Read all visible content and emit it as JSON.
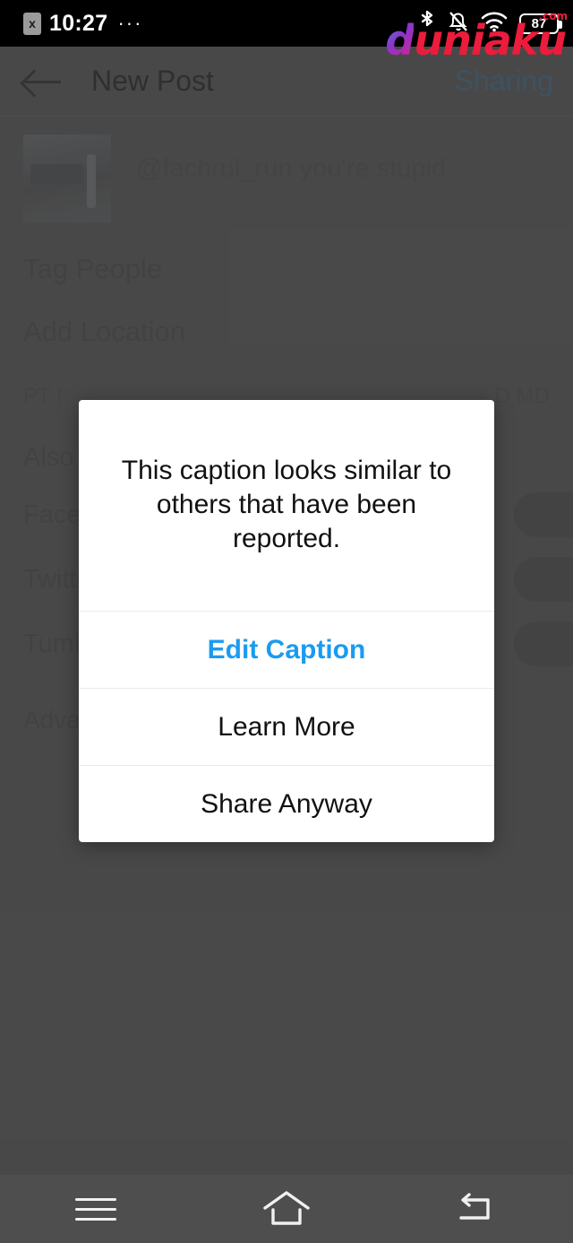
{
  "statusbar": {
    "sim_icon": "sim-card-error-icon",
    "sim_glyph": "x",
    "time": "10:27",
    "overflow": "···",
    "bluetooth_icon": "bluetooth-icon",
    "silent_icon": "bell-slash-icon",
    "wifi_icon": "wifi-icon",
    "battery_icon": "battery-icon",
    "battery_level": "87"
  },
  "watermark": {
    "brand_first": "d",
    "brand_rest": "uniaku",
    "tld": ".com"
  },
  "appbar": {
    "back_icon": "back-arrow-icon",
    "title": "New Post",
    "action": "Sharing",
    "action_color": "#3e6e91"
  },
  "post": {
    "thumbnail": "post-thumbnail",
    "caption": "@fachrul_run you're stupid"
  },
  "options": {
    "tag_people": "Tag People",
    "add_location": "Add Location",
    "location_left": "PT I",
    "location_right": "D MD"
  },
  "social": {
    "heading": "Also Post To",
    "items": [
      {
        "label": "Facebook",
        "toggle": "facebook-toggle"
      },
      {
        "label": "Twitter",
        "toggle": "twitter-toggle"
      },
      {
        "label": "Tumblr",
        "toggle": "tumblr-toggle"
      }
    ],
    "advanced": "Advanced Settings"
  },
  "dialog": {
    "message": "This caption looks similar to others that have been reported.",
    "buttons": [
      {
        "label": "Edit Caption",
        "style": "primary",
        "color": "#1b9bf0"
      },
      {
        "label": "Learn More",
        "style": "normal"
      },
      {
        "label": "Share Anyway",
        "style": "normal"
      }
    ]
  },
  "navbar": {
    "recents_icon": "menu-icon",
    "home_icon": "home-icon",
    "back_icon": "back-icon"
  }
}
